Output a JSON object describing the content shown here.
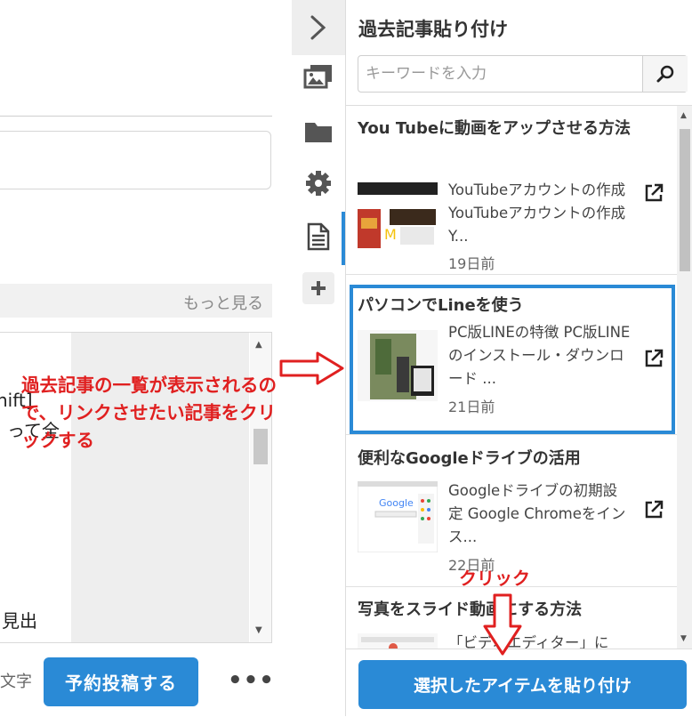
{
  "editor": {
    "more_label": "もっと見る",
    "fragments": [
      "nift]",
      "って全",
      "見出"
    ],
    "char_label": "文字",
    "schedule_button": "予約投稿する",
    "more_menu": "•••"
  },
  "toolbar": {
    "items": [
      "chevron-right-icon",
      "images-icon",
      "folder-icon",
      "gear-icon",
      "document-icon",
      "plus-icon"
    ],
    "active": "document-icon"
  },
  "panel": {
    "title": "過去記事貼り付け",
    "search": {
      "placeholder": "キーワードを入力",
      "value": ""
    },
    "articles": [
      {
        "title": "You Tubeに動画をアップさせる方法",
        "excerpt": "YouTubeアカウントの作成 YouTubeアカウントの作成 Y...",
        "date": "19日前"
      },
      {
        "title": "パソコンでLineを使う",
        "excerpt": "PC版LINEの特徴 PC版LINEのインストール・ダウンロード ...",
        "date": "21日前"
      },
      {
        "title": "便利なGoogleドライブの活用",
        "excerpt": "Googleドライブの初期設定 Google Chromeをインス...",
        "date": "22日前"
      },
      {
        "title": "写真をスライド動画にする方法",
        "excerpt": "「ビデオエディター」に",
        "date": ""
      }
    ],
    "paste_button": "選択したアイテムを貼り付け"
  },
  "annotations": {
    "note": "過去記事の一覧が表示されるので、リンクさせたい記事をクリックする",
    "click": "クリック"
  },
  "colors": {
    "accent": "#2a8ad6",
    "annotation": "#e02020"
  }
}
